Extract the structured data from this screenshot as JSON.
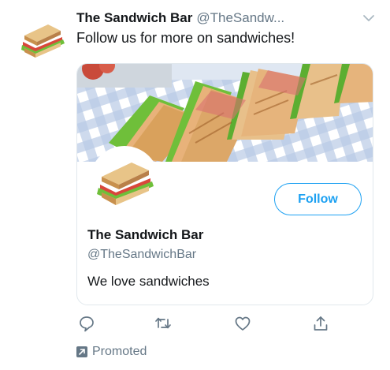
{
  "tweet": {
    "author_name": "The Sandwich Bar",
    "author_handle": "@TheSandw...",
    "text": "Follow us for more on sandwiches!"
  },
  "card": {
    "follow_label": "Follow",
    "name": "The Sandwich Bar",
    "handle": "@TheSandwichBar",
    "bio": "We love sandwiches"
  },
  "actions": {
    "icons": [
      "reply-icon",
      "retweet-icon",
      "like-icon",
      "share-icon"
    ]
  },
  "promoted": {
    "label": "Promoted",
    "icon": "promoted-arrow-icon"
  },
  "colors": {
    "accent": "#1da1f2",
    "secondary_text": "#657786",
    "primary_text": "#14171a",
    "border": "#e1e8ed"
  }
}
